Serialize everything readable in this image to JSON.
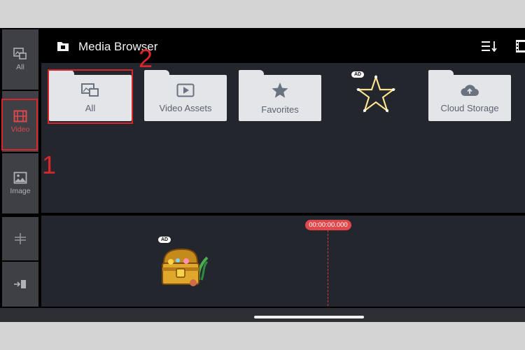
{
  "header": {
    "title": "Media Browser"
  },
  "sidebar": {
    "items": [
      {
        "label": "All",
        "icon": "image-stack-icon"
      },
      {
        "label": "Video",
        "icon": "film-icon",
        "active": true
      },
      {
        "label": "Image",
        "icon": "image-icon"
      },
      {
        "label": "",
        "icon": "split-icon"
      },
      {
        "label": "",
        "icon": "import-icon"
      }
    ]
  },
  "folders": [
    {
      "label": "All",
      "icon": "image-stack-icon"
    },
    {
      "label": "Video Assets",
      "icon": "play-icon"
    },
    {
      "label": "Favorites",
      "icon": "star-icon"
    },
    {
      "label": "Cloud Storage",
      "icon": "cloud-icon"
    }
  ],
  "ads": {
    "badge": "AD"
  },
  "annotations": {
    "one": "1",
    "two": "2"
  },
  "timeline": {
    "time": "00:00:00.000"
  },
  "colors": {
    "accent": "#e0484c",
    "annotation": "#d8262b",
    "panel": "#24262e",
    "sidebar": "#3e4046"
  }
}
